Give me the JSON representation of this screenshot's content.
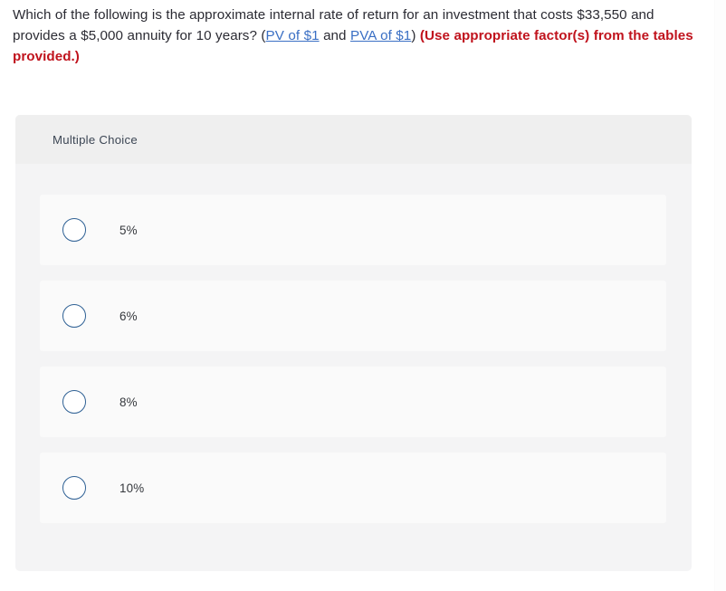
{
  "question": {
    "part1": "Which of the following is the approximate internal rate of return for an investment that costs $33,550 and provides a $5,000 annuity for 10 years? (",
    "link1": "PV of $1",
    "between_links": " and ",
    "link2": "PVA of $1",
    "part2": ") ",
    "emphasis": "(Use appropriate factor(s) from the tables provided.)",
    "link_color": "#3a6fc4",
    "emphasis_color": "#c0131d"
  },
  "multiple_choice": {
    "header_label": "Multiple Choice",
    "options": [
      {
        "label": "5%",
        "selected": false
      },
      {
        "label": "6%",
        "selected": false
      },
      {
        "label": "8%",
        "selected": false
      },
      {
        "label": "10%",
        "selected": false
      }
    ],
    "radio_border_color": "#2e6094",
    "panel_background": "#f4f4f5",
    "header_background": "#efefef",
    "option_background": "#fafafa"
  }
}
